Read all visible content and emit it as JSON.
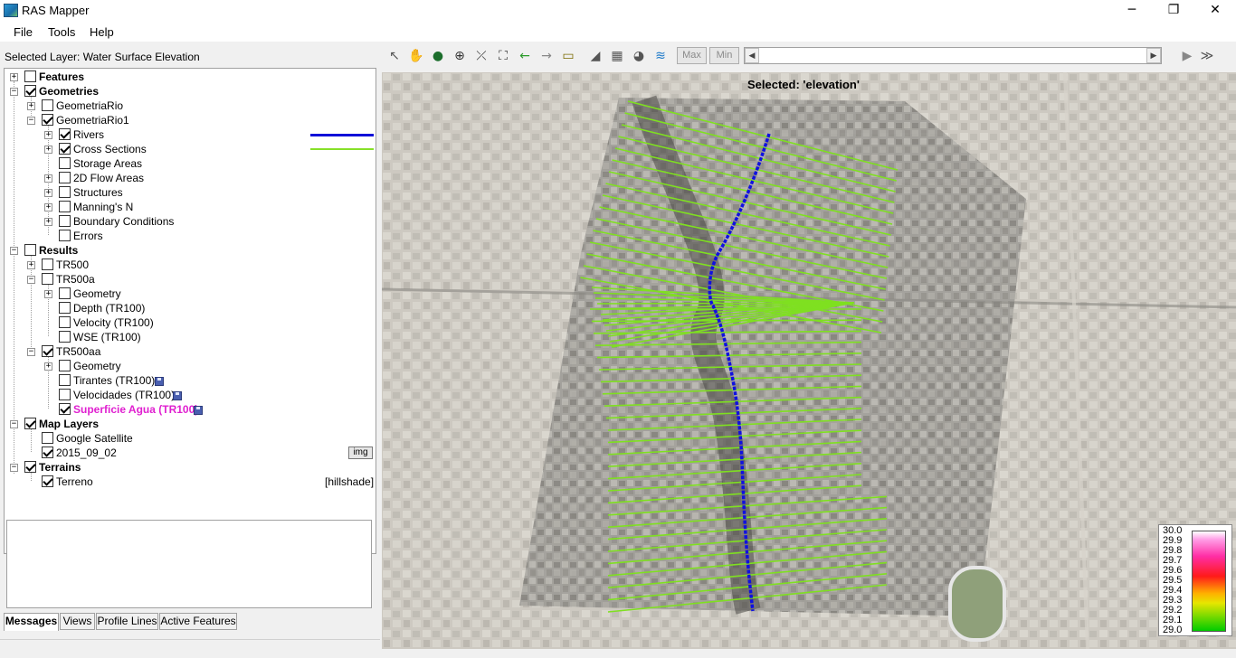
{
  "window": {
    "title": "RAS Mapper",
    "controls": {
      "minimize": "─",
      "maximize": "❐",
      "close": "✕"
    }
  },
  "menu": [
    "File",
    "Tools",
    "Help"
  ],
  "left": {
    "selected_layer": "Selected Layer: Water Surface Elevation",
    "tree": {
      "features": "Features",
      "geometries": "Geometries",
      "geometria_rio": "GeometriaRio",
      "geometria_rio1": "GeometriaRio1",
      "rivers": "Rivers",
      "cross_sections": "Cross Sections",
      "storage_areas": "Storage Areas",
      "flow_areas_2d": "2D Flow Areas",
      "structures": "Structures",
      "mannings_n": "Manning's N",
      "boundary_conditions": "Boundary Conditions",
      "errors": "Errors",
      "results": "Results",
      "tr500": "TR500",
      "tr500a": "TR500a",
      "tr500a_geometry": "Geometry",
      "tr500a_depth": "Depth (TR100)",
      "tr500a_velocity": "Velocity (TR100)",
      "tr500a_wse": "WSE (TR100)",
      "tr500aa": "TR500aa",
      "tr500aa_geometry": "Geometry",
      "tr500aa_tirantes": "Tirantes (TR100)",
      "tr500aa_velocidades": "Velocidades (TR100)",
      "tr500aa_superficie": "Superficie Agua (TR100)",
      "map_layers": "Map Layers",
      "google_satellite": "Google Satellite",
      "image_2015": "2015_09_02",
      "img_badge": "img",
      "terrains": "Terrains",
      "terreno": "Terreno",
      "hillshade": "[hillshade]"
    },
    "tabs": [
      "Messages",
      "Views",
      "Profile Lines",
      "Active Features"
    ],
    "active_tab": "Messages"
  },
  "toolbar": {
    "tools": [
      "pointer-icon",
      "pan-hand-icon",
      "globe-icon",
      "zoom-icon",
      "zoom-extent-icon",
      "full-extent-icon",
      "back-arrow-icon",
      "forward-arrow-icon",
      "measure-icon",
      "profile-icon",
      "grid-icon",
      "paint-icon",
      "layer-style-icon"
    ],
    "max_label": "Max",
    "min_label": "Min"
  },
  "map": {
    "selected_banner": "Selected: 'elevation'",
    "legend": {
      "ticks": [
        "30.0",
        "29.9",
        "29.8",
        "29.7",
        "29.6",
        "29.5",
        "29.4",
        "29.3",
        "29.2",
        "29.1",
        "29.0"
      ]
    },
    "colors": {
      "river": "#1010e0",
      "cross_sections": "#7fe020",
      "tr100": "#e020d0"
    }
  }
}
